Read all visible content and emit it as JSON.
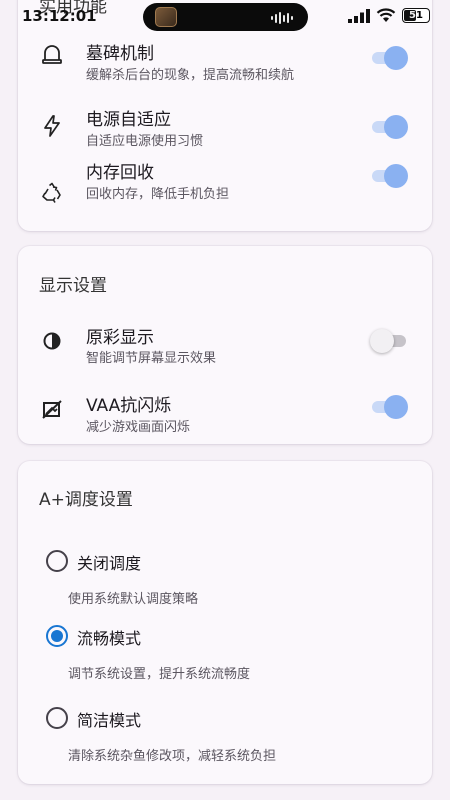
{
  "status_bar": {
    "time": "13:12:01",
    "battery": "51"
  },
  "card1": {
    "title": "实用功能",
    "items": [
      {
        "title": "墓碑机制",
        "subtitle": "缓解杀后台的现象，提高流畅和续航",
        "icon": "tombstone-icon",
        "on": true
      },
      {
        "title": "电源自适应",
        "subtitle": "自适应电源使用习惯",
        "icon": "lightning-icon",
        "on": true
      },
      {
        "title": "内存回收",
        "subtitle": "回收内存，降低手机负担",
        "icon": "recycle-icon",
        "on": true
      }
    ]
  },
  "card2": {
    "title": "显示设置",
    "items": [
      {
        "title": "原彩显示",
        "subtitle": "智能调节屏幕显示效果",
        "icon": "contrast-icon",
        "on": false
      },
      {
        "title": "VAA抗闪烁",
        "subtitle": "减少游戏画面闪烁",
        "icon": "flicker-icon",
        "on": true
      }
    ]
  },
  "card3": {
    "title": "A+调度设置",
    "options": [
      {
        "label": "关闭调度",
        "desc": "使用系统默认调度策略",
        "checked": false
      },
      {
        "label": "流畅模式",
        "desc": "调节系统设置，提升系统流畅度",
        "checked": true
      },
      {
        "label": "简洁模式",
        "desc": "清除系统杂鱼修改项，减轻系统负担",
        "checked": false
      }
    ]
  },
  "colors": {
    "accent": "#1976d2",
    "switch_on_thumb": "#8ab1f1",
    "switch_on_track": "#c9d9f7",
    "background": "#f6f1f7"
  }
}
